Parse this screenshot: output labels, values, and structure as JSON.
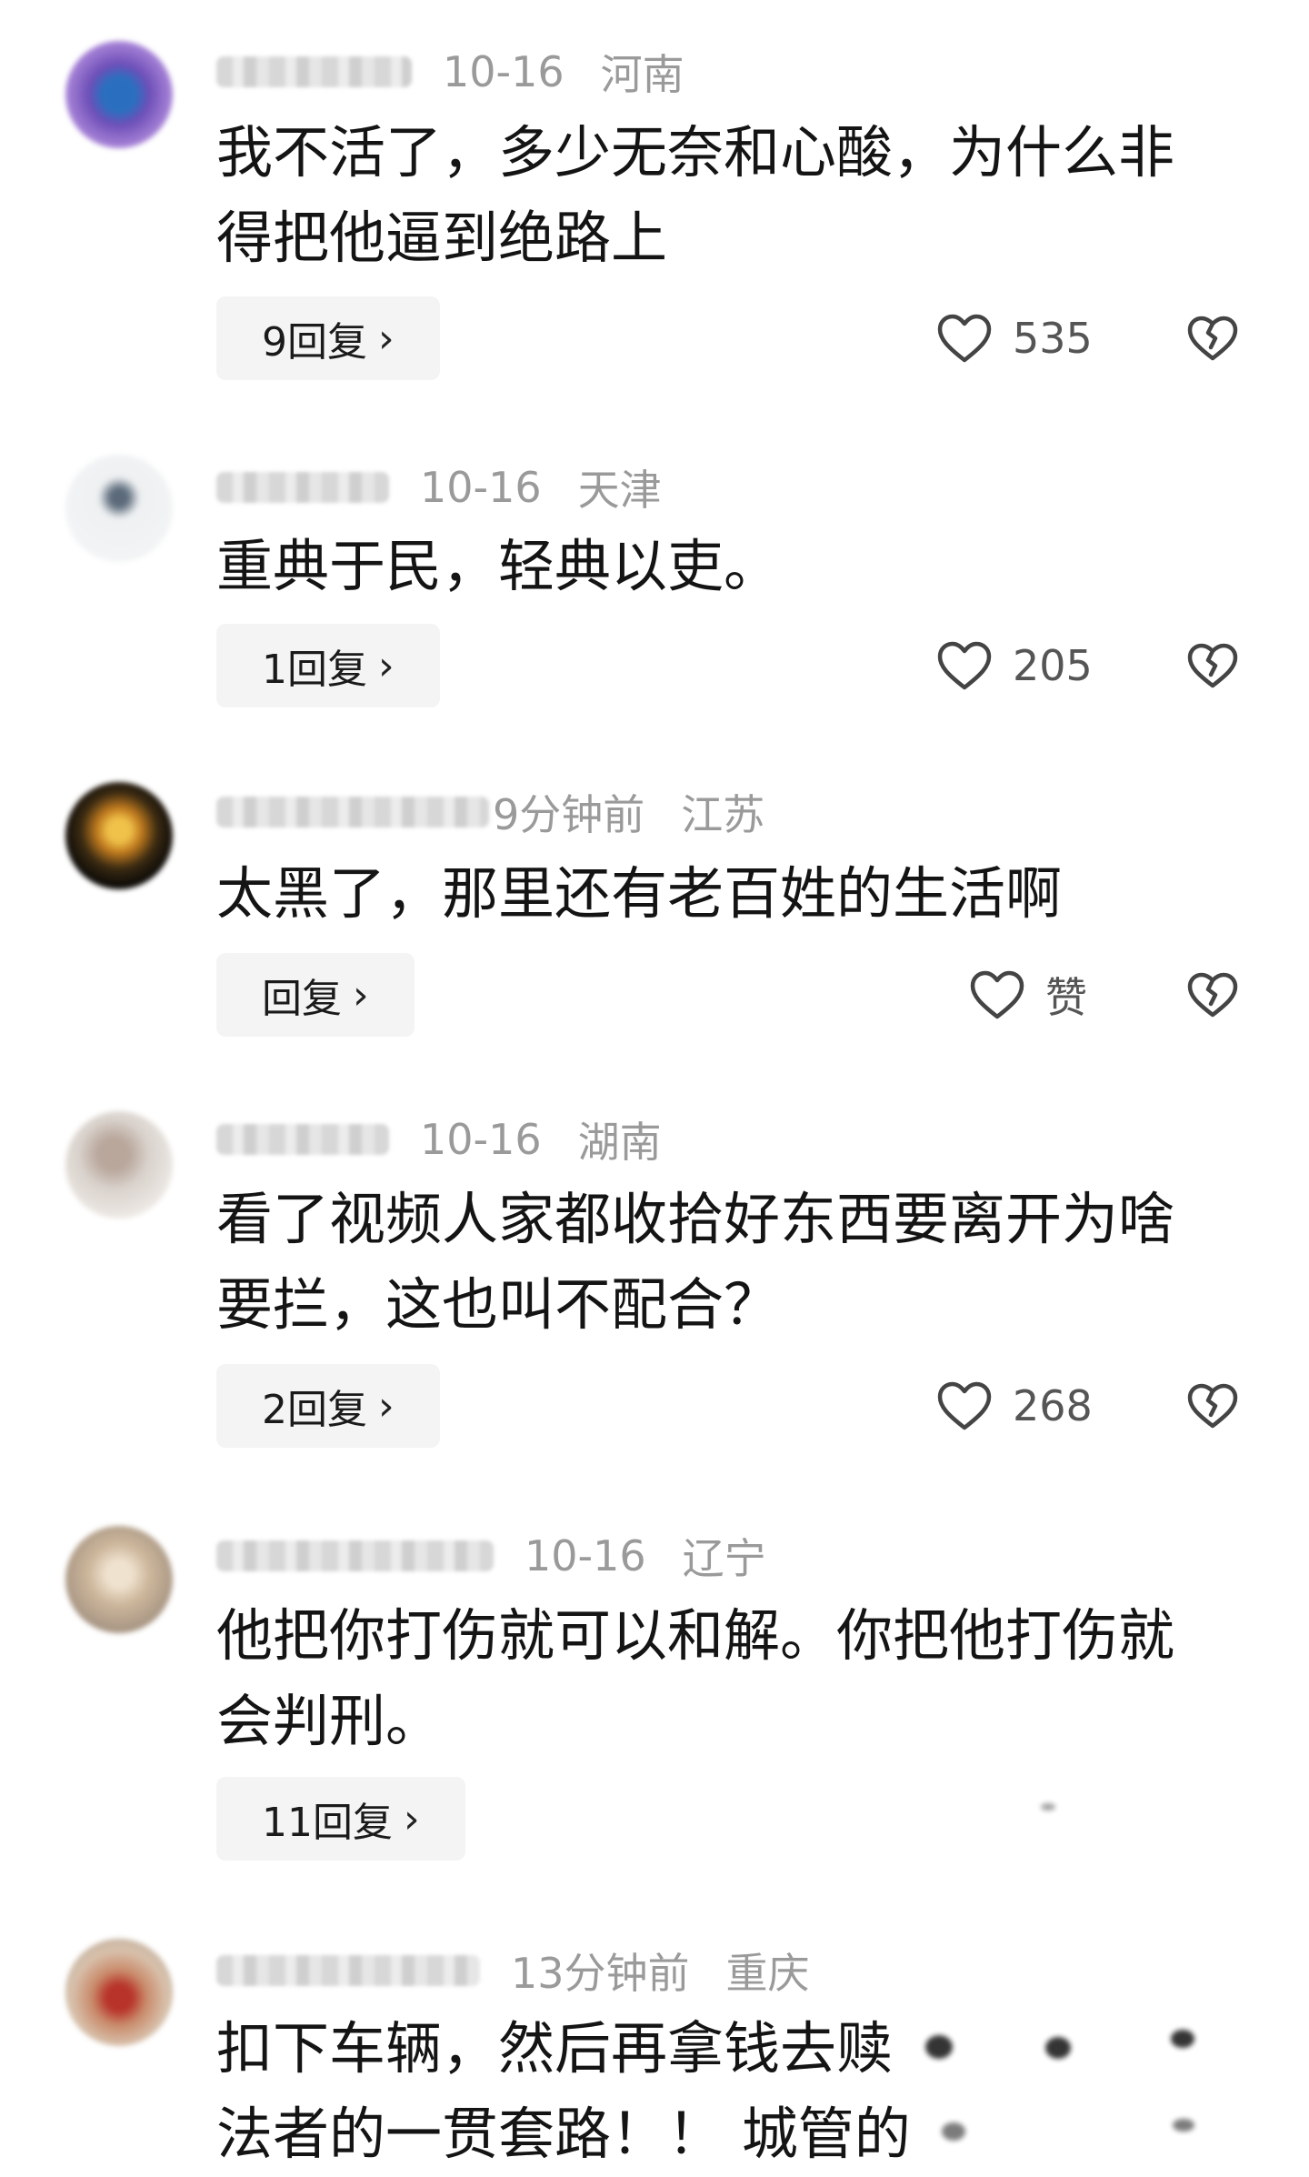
{
  "comments": [
    {
      "username": "",
      "date": "10-16",
      "location": "河南",
      "lines": [
        "我不活了，多少无奈和心酸，为什么非",
        "得把他逼到绝路上"
      ],
      "reply_label": "9回复",
      "like_count": "535"
    },
    {
      "username": "",
      "date": "10-16",
      "location": "天津",
      "lines": [
        "重典于民，轻典以吏。"
      ],
      "reply_label": "1回复",
      "like_count": "205"
    },
    {
      "username": "",
      "date": "9分钟前",
      "location": "江苏",
      "lines": [
        "太黑了，那里还有老百姓的生活啊"
      ],
      "reply_label": "回复",
      "like_count": "赞"
    },
    {
      "username": "",
      "date": "10-16",
      "location": "湖南",
      "lines": [
        "看了视频人家都收拾好东西要离开为啥",
        "要拦，这也叫不配合？"
      ],
      "reply_label": "2回复",
      "like_count": "268"
    },
    {
      "username": "",
      "date": "10-16",
      "location": "辽宁",
      "lines": [
        "他把你打伤就可以和解。你把他打伤就",
        "会判刑。"
      ],
      "reply_label": "11回复",
      "like_count": ""
    },
    {
      "username": "",
      "date": "13分钟前",
      "location": "重庆",
      "lines": [
        "扣下车辆，然后再拿钱去赎",
        "法者的一贯套路！！ 城管的"
      ],
      "reply_label": "",
      "like_count": ""
    }
  ],
  "icons": {
    "like": "heart-outline-icon",
    "dislike": "broken-heart-icon",
    "chevron": "chevron-right-icon"
  },
  "colors": {
    "meta_text": "#9a9a9a",
    "reply_bg": "#f4f4f4",
    "body_text": "#141414"
  }
}
